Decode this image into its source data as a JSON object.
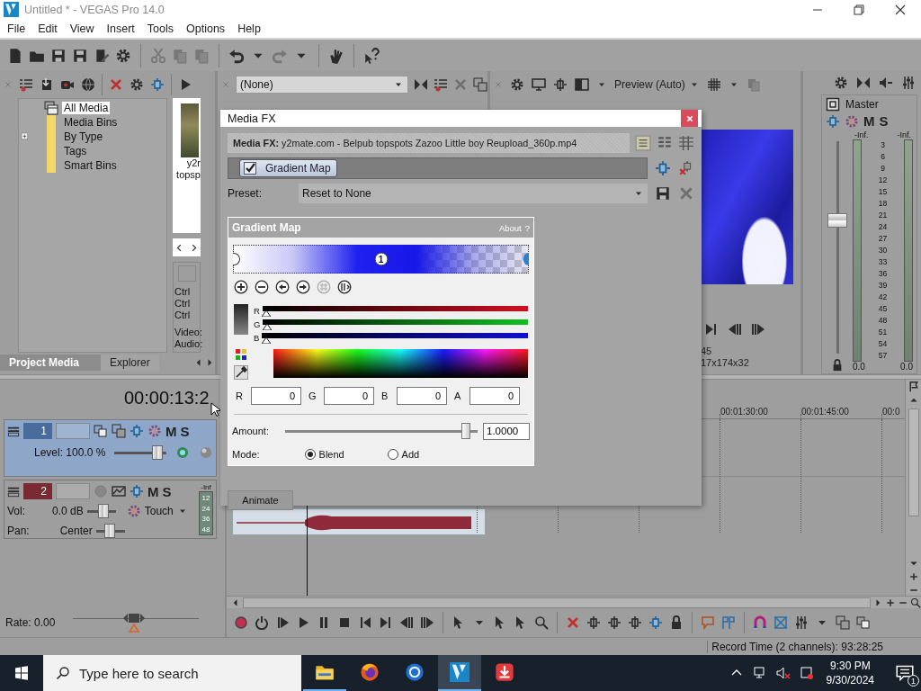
{
  "window": {
    "title": "Untitled * - VEGAS Pro 14.0"
  },
  "menu": [
    "File",
    "Edit",
    "View",
    "Insert",
    "Tools",
    "Options",
    "Help"
  ],
  "project_media": {
    "tree": [
      {
        "label": "All Media",
        "selected": true,
        "expandable": false,
        "kind": "media"
      },
      {
        "label": "Media Bins",
        "selected": false,
        "expandable": false,
        "kind": "folder"
      },
      {
        "label": "By Type",
        "selected": false,
        "expandable": true,
        "kind": "folder"
      },
      {
        "label": "Tags",
        "selected": false,
        "expandable": false,
        "kind": "folder"
      },
      {
        "label": "Smart Bins",
        "selected": false,
        "expandable": false,
        "kind": "folder"
      }
    ],
    "thumbnail_caption": [
      "y2r",
      "topsp"
    ],
    "shortcuts": [
      "Ctrl",
      "Ctrl",
      "Ctrl"
    ],
    "info": [
      "Video:",
      "Audio:"
    ],
    "tabs": [
      {
        "label": "Project Media",
        "selected": true
      },
      {
        "label": "Explorer",
        "selected": false
      }
    ]
  },
  "trimmer": {
    "dropdown": "(None)"
  },
  "preview": {
    "quality": "Preview (Auto)",
    "info": [
      "45",
      "17x174x32"
    ]
  },
  "master": {
    "label": "Master",
    "mute": "M",
    "solo": "S",
    "peaks": [
      "-Inf.",
      "-Inf."
    ],
    "scale": [
      "3",
      "6",
      "9",
      "12",
      "15",
      "18",
      "21",
      "24",
      "27",
      "30",
      "33",
      "36",
      "39",
      "42",
      "45",
      "48",
      "51",
      "54",
      "57"
    ],
    "readings": [
      "0.0",
      "0.0"
    ],
    "fader": {
      "level": 0.64
    }
  },
  "timeline": {
    "time": "00:00:13:2",
    "tracks": [
      {
        "kind": "video",
        "number": "1",
        "selected": true,
        "mute": "M",
        "solo": "S",
        "level_text": "Level: 100.0 %",
        "slider": {
          "level": 0.92
        }
      },
      {
        "kind": "audio",
        "number": "2",
        "selected": false,
        "mute": "M",
        "solo": "S",
        "meter_peak": "-Inf",
        "meter_scale": [
          "12",
          "24",
          "36",
          "48"
        ],
        "volume_label": "Vol:",
        "volume": "0.0 dB",
        "volume_slider": {
          "level": 0.62
        },
        "automation": "Touch",
        "pan_label": "Pan:",
        "pan": "Center",
        "pan_slider": {
          "level": 0.45
        }
      }
    ],
    "rate": "Rate: 0.00",
    "rate_slider": {
      "level": 0.48
    },
    "ruler": [
      "00:01:30:00",
      "00:01:45:00",
      "00:0"
    ]
  },
  "status_bar": "Record Time (2 channels): 93:28:25",
  "media_fx": {
    "title": "Media FX",
    "source": "**Media FX:** y2mate.com - Belpub topspots Zazoo Little boy Reupload_360p.mp4",
    "chain": [
      {
        "label": "Gradient Map",
        "checked": true
      }
    ],
    "preset_label": "Preset:",
    "preset": "Reset to None",
    "plugin": {
      "title": "Gradient Map",
      "about": "About",
      "help": "?",
      "marker": "1",
      "channels": [
        {
          "label": "R",
          "level": 0
        },
        {
          "label": "G",
          "level": 0
        },
        {
          "label": "B",
          "level": 0
        }
      ],
      "fields": [
        {
          "label": "R",
          "value": "0"
        },
        {
          "label": "G",
          "value": "0"
        },
        {
          "label": "B",
          "value": "0"
        },
        {
          "label": "A",
          "value": "0"
        }
      ],
      "amount_label": "Amount:",
      "amount": {
        "level": 0.96,
        "value": "1.0000"
      },
      "mode_label": "Mode:",
      "modes": [
        {
          "label": "Blend",
          "selected": true
        },
        {
          "label": "Add",
          "selected": false
        }
      ]
    },
    "animate": "Animate"
  },
  "taskbar": {
    "search_placeholder": "Type here to search",
    "apps": [
      {
        "kind": "folder",
        "running": true,
        "active": false
      },
      {
        "kind": "fox",
        "running": false,
        "active": false
      },
      {
        "kind": "globe",
        "running": false,
        "active": false
      },
      {
        "kind": "editor",
        "running": true,
        "active": true
      },
      {
        "kind": "download",
        "running": false,
        "active": false
      }
    ],
    "time": "9:30 PM",
    "date": "9/30/2024",
    "notifications": "1"
  }
}
